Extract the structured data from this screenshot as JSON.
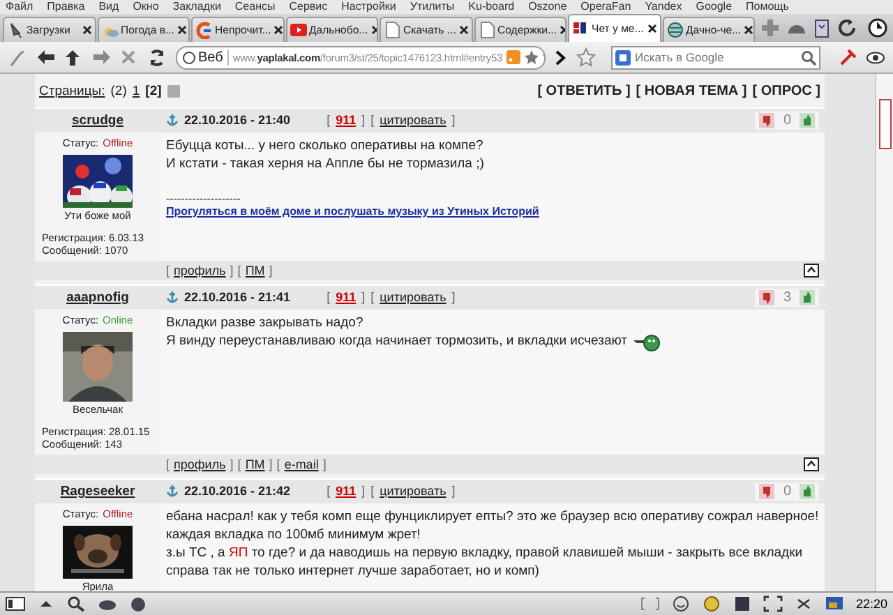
{
  "menu": [
    "Файл",
    "Правка",
    "Вид",
    "Окно",
    "Закладки",
    "Сеансы",
    "Сервис",
    "Настройки",
    "Утилиты",
    "Ku-board",
    "Oszone",
    "OperaFan",
    "Yandex",
    "Google",
    "Помощь"
  ],
  "tabs": [
    {
      "label": "Загрузки",
      "selected": false,
      "kind": "download"
    },
    {
      "label": "Погода в...",
      "selected": false,
      "kind": "weather"
    },
    {
      "label": "Непрочит...",
      "selected": false,
      "kind": "letter"
    },
    {
      "label": "Дальнобо...",
      "selected": false,
      "kind": "video"
    },
    {
      "label": "Скачать ...",
      "selected": false,
      "kind": "page"
    },
    {
      "label": "Содержки...",
      "selected": false,
      "kind": "page"
    },
    {
      "label": "Чет у ме...",
      "selected": true,
      "kind": "site"
    },
    {
      "label": "Дачно-че...",
      "selected": false,
      "kind": "globe"
    }
  ],
  "address": {
    "badge": "Веб",
    "url": "www.**yaplakal.com**/forum3/st/25/topic1476123.html#entry53",
    "search_placeholder": "Искать в Google"
  },
  "pager": {
    "label": "Страницы:",
    "count": "(2)",
    "pages": [
      {
        "label": "1",
        "selected": false
      },
      {
        "label": "[2]",
        "selected": true
      }
    ],
    "actions": [
      "[ ОТВЕТИТЬ ]",
      "[ НОВАЯ ТЕМА ]",
      "[ ОПРОС ]"
    ]
  },
  "posts": [
    {
      "author": "scrudge",
      "status_label": "Статус:",
      "status": "Offline",
      "online": false,
      "caption": "Ути боже мой",
      "registration": "Регистрация: 6.03.13",
      "messages": "Сообщений: 1070",
      "date": "22.10.2016 - 21:40",
      "number": {
        "open": "[",
        "label": "911",
        "close": "]"
      },
      "quote": {
        "open": "[",
        "label": "цитировать",
        "close": "]"
      },
      "rating": "0",
      "lines": [
        {
          "emoticon": false,
          "parts": [
            {
              "text": "Ебуцца коты... у него сколько оперативы на компе?",
              "highlight": false
            }
          ]
        },
        {
          "emoticon": false,
          "parts": [
            {
              "text": "И кстати - такая херня на Аппле бы не тормазила ;)",
              "highlight": false
            }
          ]
        }
      ],
      "signature_divider": "--------------------",
      "signature": "Прогуляться в моём доме и послушать музыку из Утиных Историй",
      "footer_links": [
        {
          "open": "[",
          "label": "профиль",
          "close": "]"
        },
        {
          "open": "[",
          "label": "ПМ",
          "close": "]"
        }
      ]
    },
    {
      "author": "aaapnofig",
      "status_label": "Статус:",
      "status": "Online",
      "online": true,
      "caption": "Весельчак",
      "registration": "Регистрация: 28.01.15",
      "messages": "Сообщений: 143",
      "date": "22.10.2016 - 21:41",
      "number": {
        "open": "[",
        "label": "911",
        "close": "]"
      },
      "quote": {
        "open": "[",
        "label": "цитировать",
        "close": "]"
      },
      "rating": "3",
      "lines": [
        {
          "emoticon": false,
          "parts": [
            {
              "text": "Вкладки разве закрывать надо?",
              "highlight": false
            }
          ]
        },
        {
          "emoticon": true,
          "parts": [
            {
              "text": "Я винду переустанавливаю когда начинает тормозить, и вкладки исчезают",
              "highlight": false
            }
          ]
        }
      ],
      "footer_links": [
        {
          "open": "[",
          "label": "профиль",
          "close": "]"
        },
        {
          "open": "[",
          "label": "ПМ",
          "close": "]"
        },
        {
          "open": "[",
          "label": "e-mail",
          "close": "]"
        }
      ]
    },
    {
      "author": "Rageseeker",
      "status_label": "Статус:",
      "status": "Offline",
      "online": false,
      "caption": "Ярила",
      "date": "22.10.2016 - 21:42",
      "number": {
        "open": "[",
        "label": "911",
        "close": "]"
      },
      "quote": {
        "open": "[",
        "label": "цитировать",
        "close": "]"
      },
      "rating": "0",
      "lines": [
        {
          "emoticon": false,
          "parts": [
            {
              "text": "ебана насрал! как у тебя комп еще фунциклирует епты? это же браузер всю оперативу сожрал наверное!",
              "highlight": false
            }
          ]
        },
        {
          "emoticon": false,
          "parts": [
            {
              "text": "каждая вкладка по 100мб минимум жрет!",
              "highlight": false
            }
          ]
        },
        {
          "emoticon": false,
          "parts": [
            {
              "text": "з.ы ТС , а",
              "highlight": false
            },
            {
              "text": "ЯП",
              "highlight": true
            },
            {
              "text": "то где? и да наводишь на первую вкладку, правой клавишей мыши - закрыть все вкладки",
              "highlight": false
            }
          ]
        },
        {
          "emoticon": false,
          "parts": [
            {
              "text": "справа так не только интернет лучше заработает, но и комп)",
              "highlight": false
            }
          ]
        }
      ]
    }
  ],
  "status_bar": {
    "time": "22:20"
  }
}
